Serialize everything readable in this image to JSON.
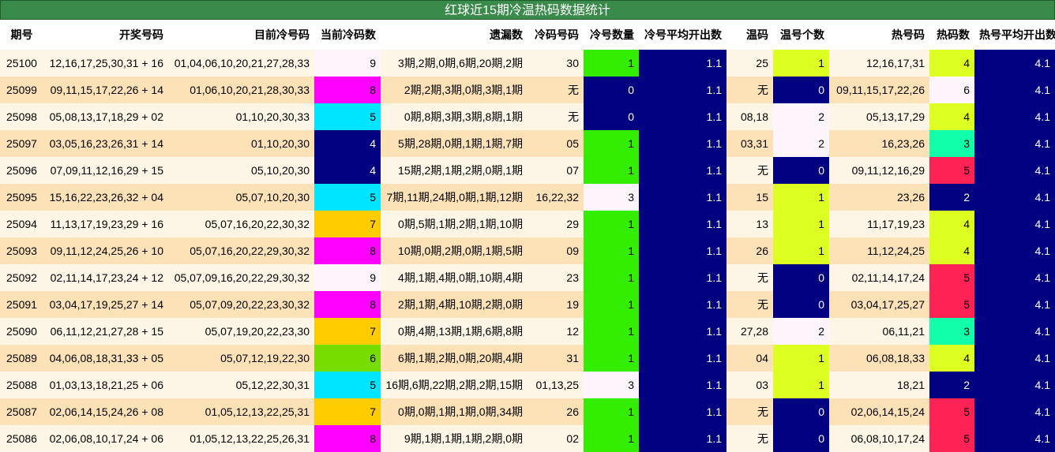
{
  "title": "红球近15期冷温热码数据统计",
  "headers": [
    "期号",
    "开奖号码",
    "目前冷号码",
    "当前冷码数",
    "遗漏数",
    "冷码号码",
    "冷号数量",
    "冷号平均开出数",
    "温码",
    "温号个数",
    "热号码",
    "热码数",
    "热号平均开出数"
  ],
  "colors": {
    "header_green": "#3a8a4b",
    "row_light": "#fdf5e6",
    "row_dark": "#fde2b8",
    "navy": "#000080",
    "magenta": "#ff00ff",
    "cyan": "#00e5ff",
    "gold": "#ffcc00",
    "green": "#33ee00",
    "lime_green": "#77dd00",
    "yellow_green": "#ddff22",
    "aqua_green": "#11ffaa",
    "red": "#ff2255",
    "white": "#fdf5fb"
  },
  "rows": [
    {
      "issue": "25100",
      "draw": "12,16,17,25,30,31 + 16",
      "cold_now": "01,04,06,10,20,21,27,28,33",
      "cold_count": "9",
      "miss": "3期,2期,0期,6期,20期,2期",
      "cold_nums": "30",
      "cold_qty": "1",
      "cold_avg": "1.1",
      "warm": "25",
      "warm_qty": "1",
      "hot_nums": "12,16,17,31",
      "hot_count": "4",
      "hot_avg": "4.1",
      "cc_color": "white",
      "cq_color": "green",
      "wq_color": "yellow_green",
      "hc_color": "yellow_green"
    },
    {
      "issue": "25099",
      "draw": "09,11,15,17,22,26 + 14",
      "cold_now": "01,06,10,20,21,28,30,33",
      "cold_count": "8",
      "miss": "2期,2期,3期,0期,3期,1期",
      "cold_nums": "无",
      "cold_qty": "0",
      "cold_avg": "1.1",
      "warm": "无",
      "warm_qty": "0",
      "hot_nums": "09,11,15,17,22,26",
      "hot_count": "6",
      "hot_avg": "4.1",
      "cc_color": "magenta",
      "cq_color": "navy",
      "wq_color": "navy",
      "hc_color": "white"
    },
    {
      "issue": "25098",
      "draw": "05,08,13,17,18,29 + 02",
      "cold_now": "01,10,20,30,33",
      "cold_count": "5",
      "miss": "0期,8期,3期,3期,8期,1期",
      "cold_nums": "无",
      "cold_qty": "0",
      "cold_avg": "1.1",
      "warm": "08,18",
      "warm_qty": "2",
      "hot_nums": "05,13,17,29",
      "hot_count": "4",
      "hot_avg": "4.1",
      "cc_color": "cyan",
      "cq_color": "navy",
      "wq_color": "white",
      "hc_color": "yellow_green"
    },
    {
      "issue": "25097",
      "draw": "03,05,16,23,26,31 + 14",
      "cold_now": "01,10,20,30",
      "cold_count": "4",
      "miss": "5期,28期,0期,1期,1期,7期",
      "cold_nums": "05",
      "cold_qty": "1",
      "cold_avg": "1.1",
      "warm": "03,31",
      "warm_qty": "2",
      "hot_nums": "16,23,26",
      "hot_count": "3",
      "hot_avg": "4.1",
      "cc_color": "navy",
      "cq_color": "green",
      "wq_color": "white",
      "hc_color": "aqua_green"
    },
    {
      "issue": "25096",
      "draw": "07,09,11,12,16,29 + 15",
      "cold_now": "05,10,20,30",
      "cold_count": "4",
      "miss": "15期,2期,1期,2期,0期,1期",
      "cold_nums": "07",
      "cold_qty": "1",
      "cold_avg": "1.1",
      "warm": "无",
      "warm_qty": "0",
      "hot_nums": "09,11,12,16,29",
      "hot_count": "5",
      "hot_avg": "4.1",
      "cc_color": "navy",
      "cq_color": "green",
      "wq_color": "navy",
      "hc_color": "red"
    },
    {
      "issue": "25095",
      "draw": "15,16,22,23,26,32 + 04",
      "cold_now": "05,07,10,20,30",
      "cold_count": "5",
      "miss": "7期,11期,24期,0期,1期,12期",
      "cold_nums": "16,22,32",
      "cold_qty": "3",
      "cold_avg": "1.1",
      "warm": "15",
      "warm_qty": "1",
      "hot_nums": "23,26",
      "hot_count": "2",
      "hot_avg": "4.1",
      "cc_color": "cyan",
      "cq_color": "white",
      "wq_color": "yellow_green",
      "hc_color": "navy"
    },
    {
      "issue": "25094",
      "draw": "11,13,17,19,23,29 + 16",
      "cold_now": "05,07,16,20,22,30,32",
      "cold_count": "7",
      "miss": "0期,5期,1期,2期,1期,10期",
      "cold_nums": "29",
      "cold_qty": "1",
      "cold_avg": "1.1",
      "warm": "13",
      "warm_qty": "1",
      "hot_nums": "11,17,19,23",
      "hot_count": "4",
      "hot_avg": "4.1",
      "cc_color": "gold",
      "cq_color": "green",
      "wq_color": "yellow_green",
      "hc_color": "yellow_green"
    },
    {
      "issue": "25093",
      "draw": "09,11,12,24,25,26 + 10",
      "cold_now": "05,07,16,20,22,29,30,32",
      "cold_count": "8",
      "miss": "10期,0期,2期,0期,1期,5期",
      "cold_nums": "09",
      "cold_qty": "1",
      "cold_avg": "1.1",
      "warm": "26",
      "warm_qty": "1",
      "hot_nums": "11,12,24,25",
      "hot_count": "4",
      "hot_avg": "4.1",
      "cc_color": "magenta",
      "cq_color": "green",
      "wq_color": "yellow_green",
      "hc_color": "yellow_green"
    },
    {
      "issue": "25092",
      "draw": "02,11,14,17,23,24 + 12",
      "cold_now": "05,07,09,16,20,22,29,30,32",
      "cold_count": "9",
      "miss": "4期,1期,4期,0期,10期,4期",
      "cold_nums": "23",
      "cold_qty": "1",
      "cold_avg": "1.1",
      "warm": "无",
      "warm_qty": "0",
      "hot_nums": "02,11,14,17,24",
      "hot_count": "5",
      "hot_avg": "4.1",
      "cc_color": "white",
      "cq_color": "green",
      "wq_color": "navy",
      "hc_color": "red"
    },
    {
      "issue": "25091",
      "draw": "03,04,17,19,25,27 + 14",
      "cold_now": "05,07,09,20,22,23,30,32",
      "cold_count": "8",
      "miss": "2期,1期,4期,10期,2期,0期",
      "cold_nums": "19",
      "cold_qty": "1",
      "cold_avg": "1.1",
      "warm": "无",
      "warm_qty": "0",
      "hot_nums": "03,04,17,25,27",
      "hot_count": "5",
      "hot_avg": "4.1",
      "cc_color": "magenta",
      "cq_color": "green",
      "wq_color": "navy",
      "hc_color": "red"
    },
    {
      "issue": "25090",
      "draw": "06,11,12,21,27,28 + 15",
      "cold_now": "05,07,19,20,22,23,30",
      "cold_count": "7",
      "miss": "0期,4期,13期,1期,6期,8期",
      "cold_nums": "12",
      "cold_qty": "1",
      "cold_avg": "1.1",
      "warm": "27,28",
      "warm_qty": "2",
      "hot_nums": "06,11,21",
      "hot_count": "3",
      "hot_avg": "4.1",
      "cc_color": "gold",
      "cq_color": "green",
      "wq_color": "white",
      "hc_color": "aqua_green"
    },
    {
      "issue": "25089",
      "draw": "04,06,08,18,31,33 + 05",
      "cold_now": "05,07,12,19,22,30",
      "cold_count": "6",
      "miss": "6期,1期,2期,0期,20期,4期",
      "cold_nums": "31",
      "cold_qty": "1",
      "cold_avg": "1.1",
      "warm": "04",
      "warm_qty": "1",
      "hot_nums": "06,08,18,33",
      "hot_count": "4",
      "hot_avg": "4.1",
      "cc_color": "lime_green",
      "cq_color": "green",
      "wq_color": "yellow_green",
      "hc_color": "yellow_green"
    },
    {
      "issue": "25088",
      "draw": "01,03,13,18,21,25 + 06",
      "cold_now": "05,12,22,30,31",
      "cold_count": "5",
      "miss": "16期,6期,22期,2期,2期,15期",
      "cold_nums": "01,13,25",
      "cold_qty": "3",
      "cold_avg": "1.1",
      "warm": "03",
      "warm_qty": "1",
      "hot_nums": "18,21",
      "hot_count": "2",
      "hot_avg": "4.1",
      "cc_color": "cyan",
      "cq_color": "white",
      "wq_color": "yellow_green",
      "hc_color": "navy"
    },
    {
      "issue": "25087",
      "draw": "02,06,14,15,24,26 + 08",
      "cold_now": "01,05,12,13,22,25,31",
      "cold_count": "7",
      "miss": "0期,0期,1期,1期,0期,34期",
      "cold_nums": "26",
      "cold_qty": "1",
      "cold_avg": "1.1",
      "warm": "无",
      "warm_qty": "0",
      "hot_nums": "02,06,14,15,24",
      "hot_count": "5",
      "hot_avg": "4.1",
      "cc_color": "gold",
      "cq_color": "green",
      "wq_color": "navy",
      "hc_color": "red"
    },
    {
      "issue": "25086",
      "draw": "02,06,08,10,17,24 + 06",
      "cold_now": "01,05,12,13,22,25,26,31",
      "cold_count": "8",
      "miss": "9期,1期,1期,1期,2期,0期",
      "cold_nums": "02",
      "cold_qty": "1",
      "cold_avg": "1.1",
      "warm": "无",
      "warm_qty": "0",
      "hot_nums": "06,08,10,17,24",
      "hot_count": "5",
      "hot_avg": "4.1",
      "cc_color": "magenta",
      "cq_color": "green",
      "wq_color": "navy",
      "hc_color": "red"
    }
  ]
}
